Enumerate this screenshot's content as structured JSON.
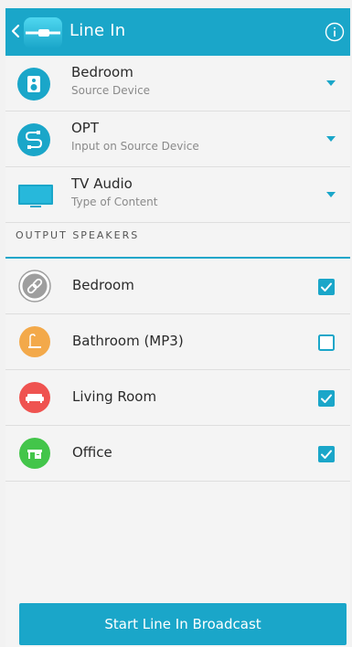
{
  "header": {
    "title": "Line In",
    "back_icon": "chevron-left-icon",
    "app_icon": "line-in-cable-icon",
    "info_icon": "info-icon"
  },
  "source": {
    "rows": [
      {
        "name": "Bedroom",
        "subtitle": "Source Device",
        "icon": "speaker-icon"
      },
      {
        "name": "OPT",
        "subtitle": "Input on Source Device",
        "icon": "cable-icon"
      },
      {
        "name": "TV Audio",
        "subtitle": "Type of Content",
        "icon": "tv-icon"
      }
    ]
  },
  "output": {
    "section_label": "OUTPUT SPEAKERS",
    "speakers": [
      {
        "name": "Bedroom",
        "checked": true,
        "icon": "link-icon",
        "color": "#9e9e9e"
      },
      {
        "name": "Bathroom (MP3)",
        "checked": false,
        "icon": "bathroom-icon",
        "color": "#f3a94a"
      },
      {
        "name": "Living Room",
        "checked": true,
        "icon": "sofa-icon",
        "color": "#ef5350"
      },
      {
        "name": "Office",
        "checked": true,
        "icon": "desk-icon",
        "color": "#43c54a"
      }
    ]
  },
  "footer": {
    "broadcast_label": "Start Line In Broadcast"
  },
  "colors": {
    "accent": "#1aa6c9",
    "background": "#f4f4f4"
  }
}
